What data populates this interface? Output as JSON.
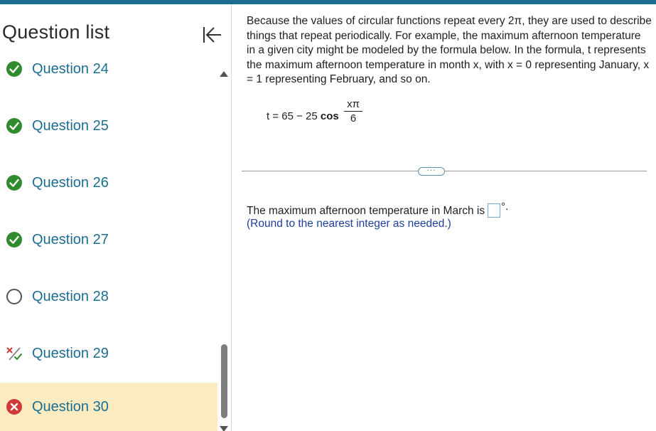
{
  "sidebar": {
    "title": "Question list",
    "items": [
      {
        "label": "Question 24",
        "status": "correct"
      },
      {
        "label": "Question 25",
        "status": "correct"
      },
      {
        "label": "Question 26",
        "status": "correct"
      },
      {
        "label": "Question 27",
        "status": "correct"
      },
      {
        "label": "Question 28",
        "status": "not-attempted"
      },
      {
        "label": "Question 29",
        "status": "partially-correct"
      },
      {
        "label": "Question 30",
        "status": "incorrect",
        "active": true
      }
    ]
  },
  "question": {
    "text": "Because the values of circular functions repeat every 2π, they are used to describe things that repeat periodically. For example, the maximum afternoon temperature in a given city might be modeled by the formula below. In the formula, t represents the maximum afternoon temperature in month x, with x = 0 representing January, x = 1 representing February, and so on.",
    "formula": {
      "lhs": "t = 65 − 25 ",
      "func": "cos",
      "numerator": "xπ",
      "denominator": "6"
    },
    "more_label": "···",
    "prompt": "The maximum afternoon temperature in March is",
    "unit": "°.",
    "hint": "(Round to the nearest integer as needed.)"
  },
  "colors": {
    "accent": "#1b6e90",
    "topbar": "#1d6c8d",
    "correct": "#2e8b2e",
    "incorrect": "#d23a3a",
    "active_bg": "#faecc0",
    "hint": "#1e3f9a"
  }
}
